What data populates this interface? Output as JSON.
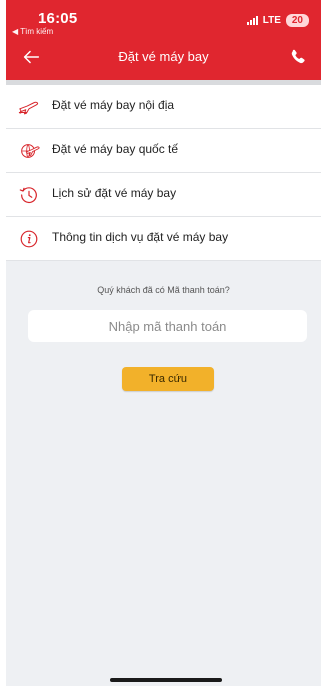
{
  "status_bar": {
    "time": "16:05",
    "back_label": "◀ Tìm kiếm",
    "network": "LTE",
    "battery": "20"
  },
  "header": {
    "title": "Đặt vé máy bay",
    "back_icon": "arrow-left-icon",
    "phone_icon": "phone-icon"
  },
  "menu": {
    "items": [
      {
        "label": "Đặt vé máy bay nội địa",
        "icon": "plane-domestic-icon"
      },
      {
        "label": "Đặt vé máy bay quốc tế",
        "icon": "plane-globe-icon"
      },
      {
        "label": "Lịch sử đặt vé máy bay",
        "icon": "history-clock-icon"
      },
      {
        "label": "Thông tin dịch vụ đặt vé máy bay",
        "icon": "info-icon"
      }
    ]
  },
  "lookup": {
    "question": "Quý khách đã có Mã thanh toán?",
    "placeholder": "Nhập mã thanh toán",
    "button_label": "Tra cứu"
  },
  "colors": {
    "brand_red": "#e0262f",
    "button_yellow": "#f2b12a",
    "background": "#eef0f3"
  }
}
